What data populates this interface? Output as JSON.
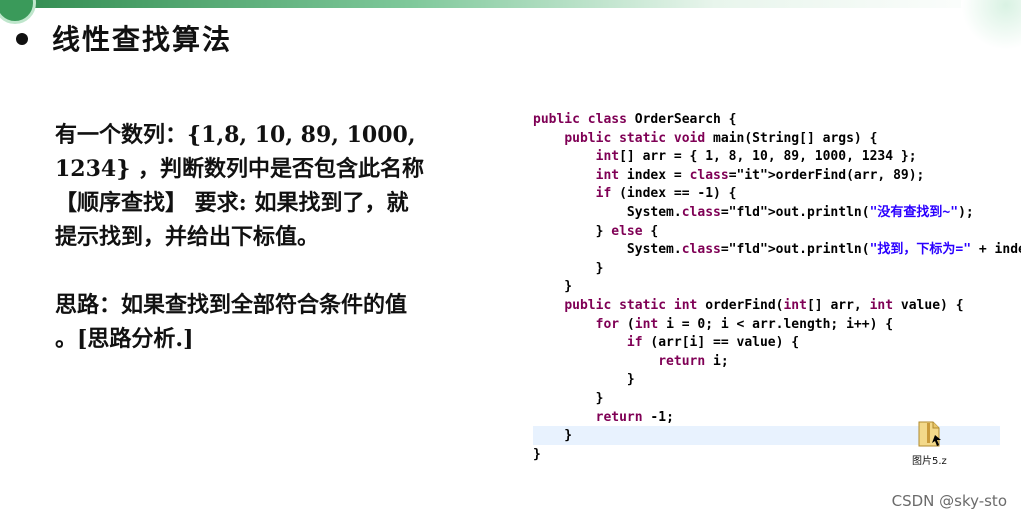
{
  "slide": {
    "heading": "线性查找算法",
    "description": "有一个数列：{1,8, 10, 89, 1000,\n1234} ，判断数列中是否包含此名称\n【顺序查找】 要求: 如果找到了，就\n提示找到，并给出下标值。\n\n思路：如果查找到全部符合条件的值\n。[思路分析.]"
  },
  "code": {
    "lines": [
      "public class OrderSearch {",
      "    public static void main(String[] args) {",
      "        int[] arr = { 1, 8, 10, 89, 1000, 1234 };",
      "        int index = orderFind(arr, 89);",
      "        if (index == -1) {",
      "            System.out.println(\"没有查找到~\");",
      "        } else {",
      "            System.out.println(\"找到，下标为=\" + index);",
      "        }",
      "    }",
      "    public static int orderFind(int[] arr, int value) {",
      "        for (int i = 0; i < arr.length; i++) {",
      "            if (arr[i] == value) {",
      "                return i;",
      "            }",
      "        }",
      "        return -1;",
      "    }",
      "}"
    ]
  },
  "file": {
    "label": "图片5.z",
    "icon": "file-icon"
  },
  "watermark": "CSDN @sky-sto",
  "colors": {
    "keyword": "#7f0055",
    "string": "#2a00ff",
    "field": "#0000c0",
    "highlight": "#e8f2fe",
    "accent": "#3a9a5a"
  }
}
